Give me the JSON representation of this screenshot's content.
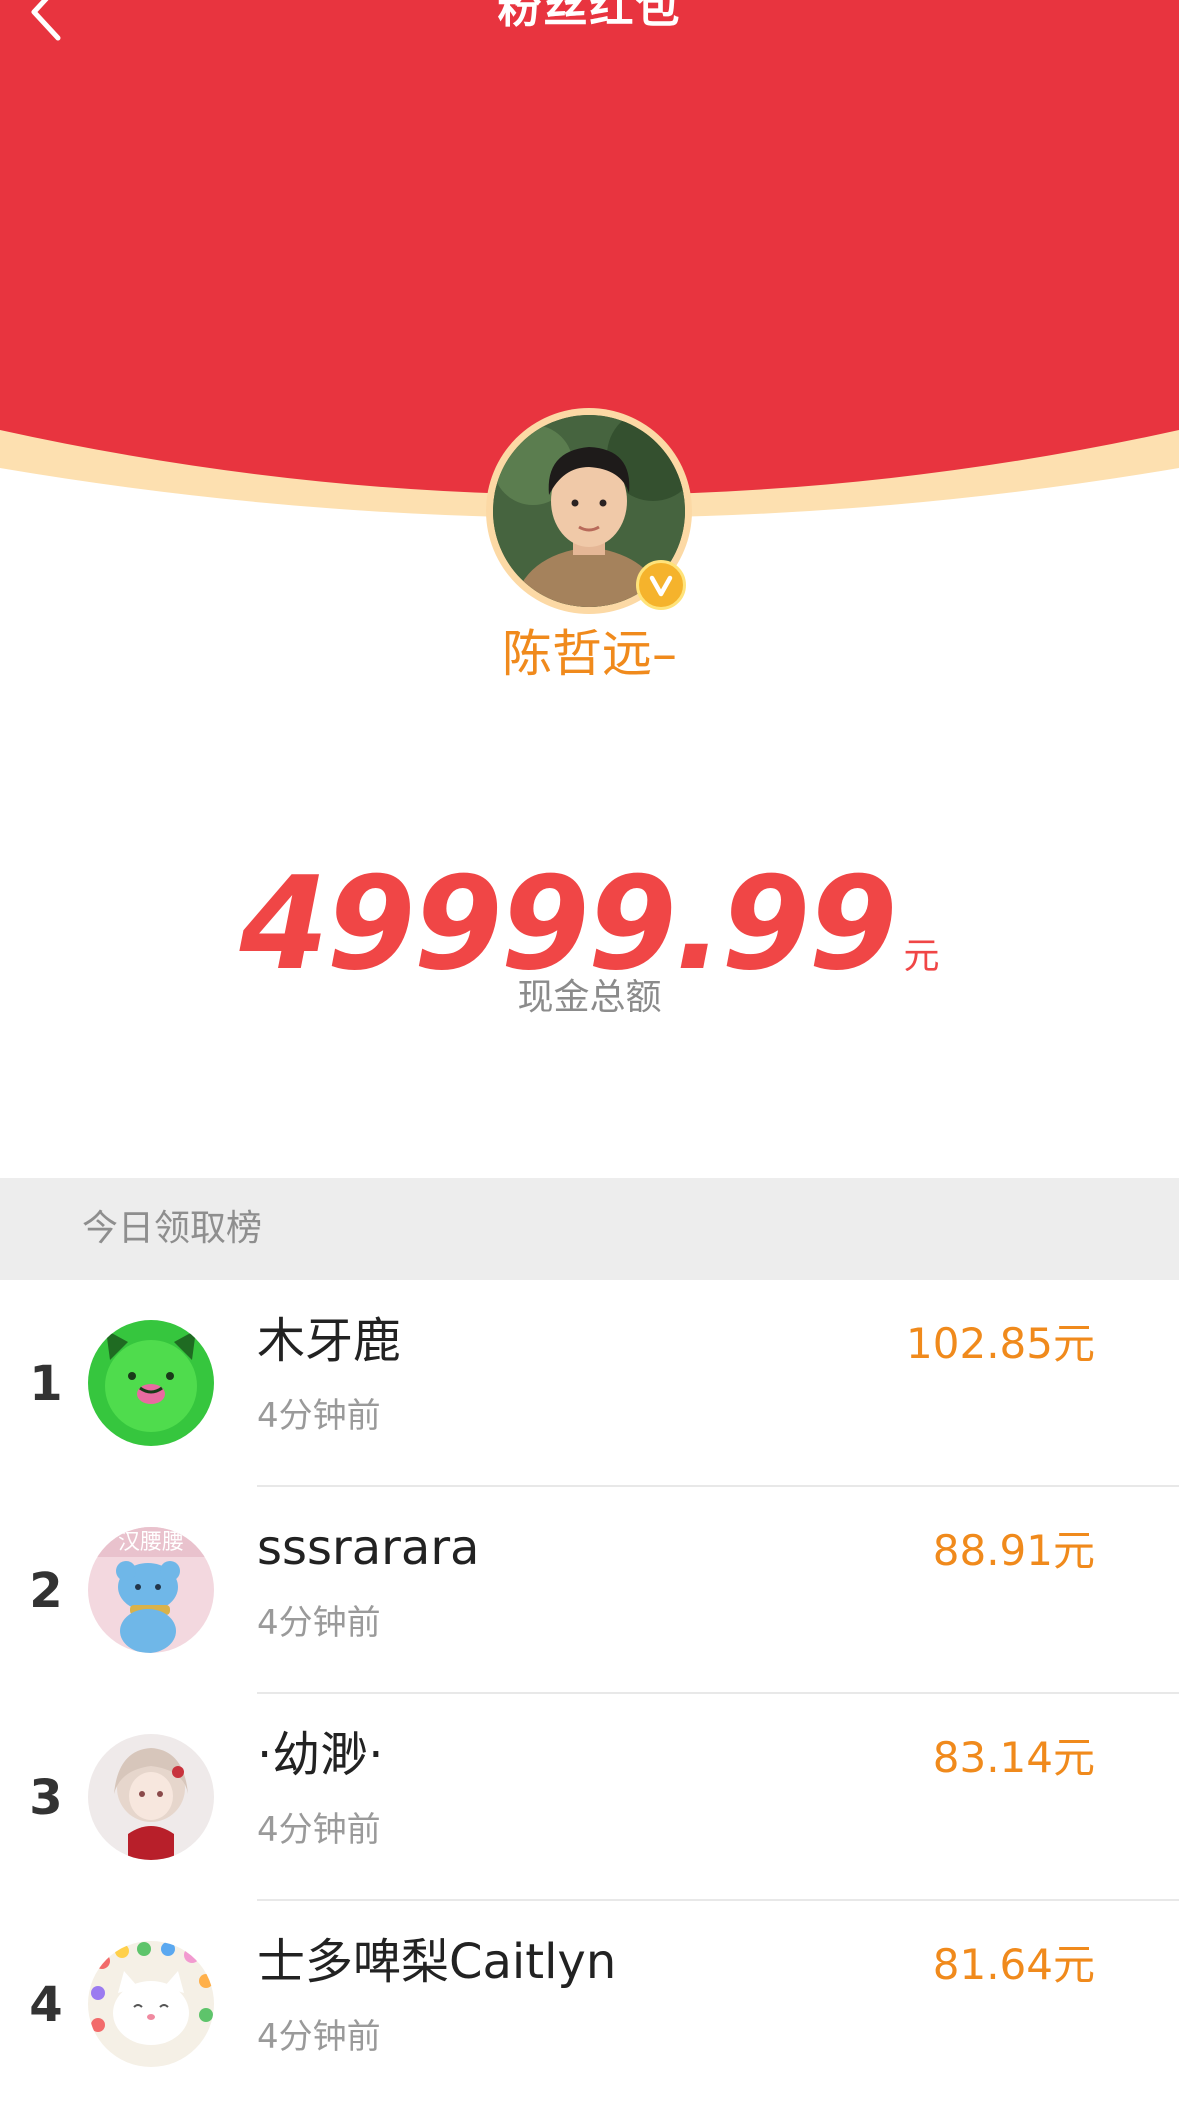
{
  "header": {
    "title": "粉丝红包",
    "back_icon": "chevron-left-icon",
    "bg_color": "#e8343f",
    "rim_color": "#fde0b0"
  },
  "host": {
    "name": "陈哲远–",
    "verified_icon": "verified-v-icon",
    "accent_color": "#f08a1c"
  },
  "amount": {
    "value": "49999.99",
    "unit": "元",
    "caption": "现金总额",
    "color": "#f04646"
  },
  "ranking": {
    "title": "今日领取榜",
    "rows": [
      {
        "rank": "1",
        "name": "木牙鹿",
        "time": "4分钟前",
        "amount": "102.85元"
      },
      {
        "rank": "2",
        "name": "sssrarara",
        "time": "4分钟前",
        "amount": "88.91元",
        "avatar_text": "汉腰腰"
      },
      {
        "rank": "3",
        "name": "·幼渺·",
        "time": "4分钟前",
        "amount": "83.14元"
      },
      {
        "rank": "4",
        "name": "士多啤梨Caitlyn",
        "time": "4分钟前",
        "amount": "81.64元"
      }
    ]
  }
}
